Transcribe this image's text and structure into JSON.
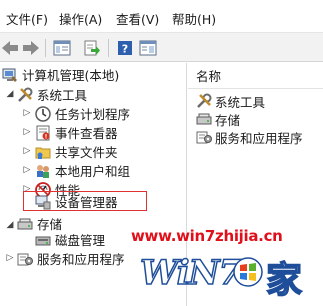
{
  "menubar": {
    "items": [
      "文件(F)",
      "操作(A)",
      "查看(V)",
      "帮助(H)"
    ]
  },
  "toolbar": {
    "buttons": [
      "back-icon",
      "forward-icon",
      "show-hide-tree-icon",
      "export-list-icon",
      "help-icon",
      "properties-icon"
    ]
  },
  "tree": {
    "root": "计算机管理(本地)",
    "system_tools": "系统工具",
    "task_scheduler": "任务计划程序",
    "event_viewer": "事件查看器",
    "shared_folders": "共享文件夹",
    "local_users": "本地用户和组",
    "performance": "性能",
    "device_manager": "设备管理器",
    "storage": "存储",
    "disk_management": "磁盘管理",
    "services_apps": "服务和应用程序"
  },
  "right_pane": {
    "column_header": "名称",
    "items": [
      "系统工具",
      "存储",
      "服务和应用程序"
    ]
  },
  "watermark": {
    "url": "www.win7zhijia.cn",
    "logo_text": "WiN7",
    "logo_char": "家"
  },
  "colors": {
    "highlight": "#e03030",
    "watermark_red": "#e0101a",
    "logo_blue": "#1e4e9a"
  }
}
